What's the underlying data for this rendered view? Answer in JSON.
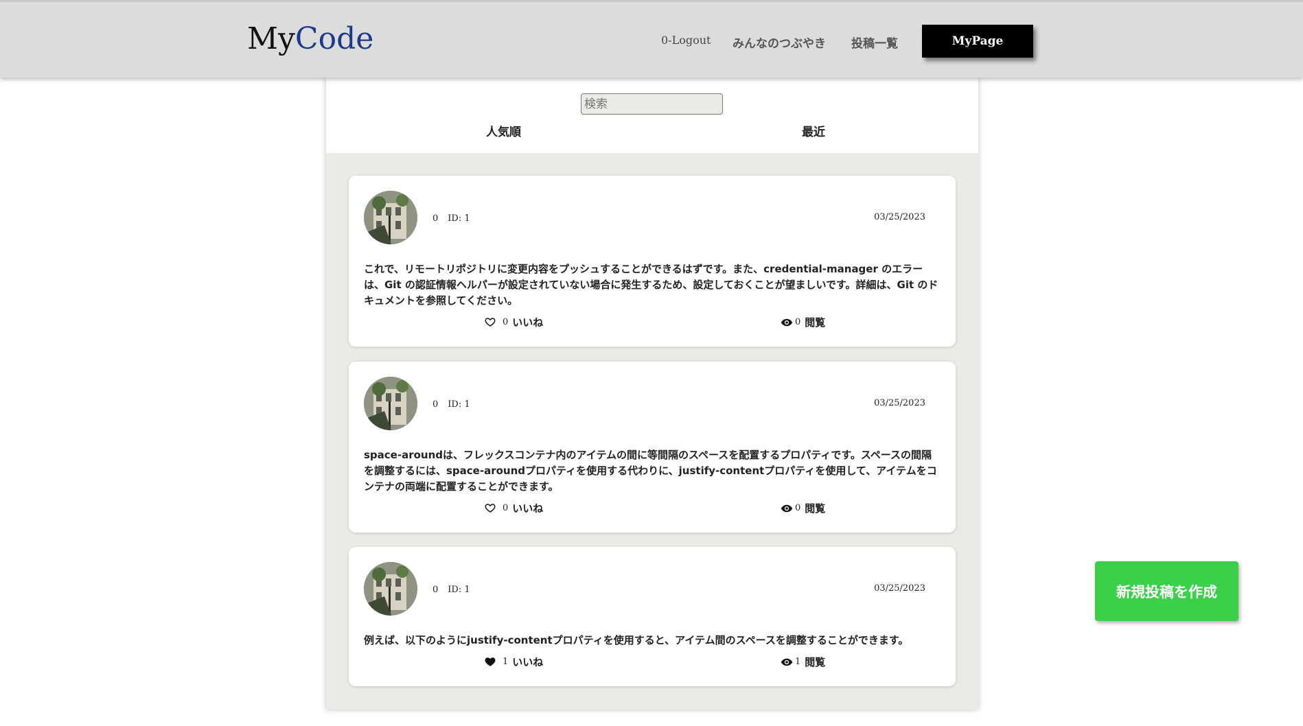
{
  "header": {
    "logo_main": "My",
    "logo_accent": "Code",
    "nav": {
      "logout": "0-Logout",
      "mutter": "みんなのつぶやき",
      "posts": "投稿一覧",
      "mypage": "MyPage"
    }
  },
  "controls": {
    "search_placeholder": "検索",
    "sort_popular": "人気順",
    "sort_recent": "最近"
  },
  "posts": [
    {
      "count": "0",
      "id": "ID: 1",
      "date": "03/25/2023",
      "body": "これで、リモートリポジトリに変更内容をプッシュすることができるはずです。また、credential-manager のエラーは、Git の認証情報ヘルパーが設定されていない場合に発生するため、設定しておくことが望ましいです。詳細は、Git のドキュメントを参照してください。",
      "likes": "0",
      "likes_label": "いいね",
      "liked": false,
      "views": "0",
      "views_label": "閲覧"
    },
    {
      "count": "0",
      "id": "ID: 1",
      "date": "03/25/2023",
      "body": "space-aroundは、フレックスコンテナ内のアイテムの間に等間隔のスペースを配置するプロパティです。スペースの間隔を調整するには、space-aroundプロパティを使用する代わりに、justify-contentプロパティを使用して、アイテムをコンテナの両端に配置することができます。",
      "likes": "0",
      "likes_label": "いいね",
      "liked": false,
      "views": "0",
      "views_label": "閲覧"
    },
    {
      "count": "0",
      "id": "ID: 1",
      "date": "03/25/2023",
      "body": "例えば、以下のようにjustify-contentプロパティを使用すると、アイテム間のスペースを調整することができます。",
      "likes": "1",
      "likes_label": "いいね",
      "liked": true,
      "views": "1",
      "views_label": "閲覧"
    }
  ],
  "new_post_button": "新規投稿を作成",
  "colors": {
    "header_bg": "#dcdcdc",
    "logo_accent": "#1c3a8c",
    "mypage_bg": "#000000",
    "new_post_bg": "#3ad04a",
    "main_bg": "#eaeae6"
  }
}
